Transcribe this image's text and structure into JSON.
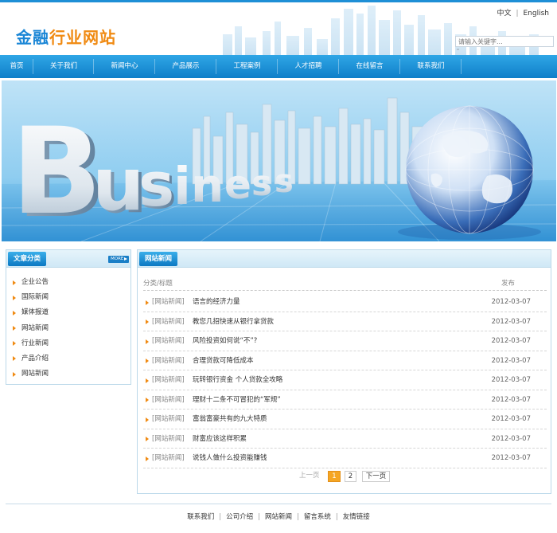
{
  "header": {
    "logo_part1": "金融",
    "logo_part2": "行业网站",
    "lang_zh": "中文",
    "lang_sep": "|",
    "lang_en": "English",
    "search_placeholder": "请输入关键字..."
  },
  "nav": {
    "items": [
      {
        "label": "首页"
      },
      {
        "label": "关于我们"
      },
      {
        "label": "新闻中心"
      },
      {
        "label": "产品展示"
      },
      {
        "label": "工程案例"
      },
      {
        "label": "人才招聘"
      },
      {
        "label": "在线留言"
      },
      {
        "label": "联系我们"
      }
    ]
  },
  "banner": {
    "word": "Business"
  },
  "sidebar": {
    "title": "文章分类",
    "more_label": "MORE",
    "items": [
      {
        "label": "企业公告"
      },
      {
        "label": "国际新闻"
      },
      {
        "label": "媒体报道"
      },
      {
        "label": "网站新闻"
      },
      {
        "label": "行业新闻"
      },
      {
        "label": "产品介绍"
      },
      {
        "label": "网站新闻"
      }
    ]
  },
  "main": {
    "title": "网站新闻",
    "col_category_title": "分类/标题",
    "col_date": "发布",
    "rows": [
      {
        "category": "[网站新闻]",
        "title": "语言的经济力量",
        "date": "2012-03-07"
      },
      {
        "category": "[网站新闻]",
        "title": "教您几招快速从银行拿贷款",
        "date": "2012-03-07"
      },
      {
        "category": "[网站新闻]",
        "title": "风险投资如何说“不”?",
        "date": "2012-03-07"
      },
      {
        "category": "[网站新闻]",
        "title": "合理贷款可降低成本",
        "date": "2012-03-07"
      },
      {
        "category": "[网站新闻]",
        "title": "玩转银行资金 个人贷款全攻略",
        "date": "2012-03-07"
      },
      {
        "category": "[网站新闻]",
        "title": "理财十二条不可冒犯的“军规”",
        "date": "2012-03-07"
      },
      {
        "category": "[网站新闻]",
        "title": "富翁富豪共有的九大特质",
        "date": "2012-03-07"
      },
      {
        "category": "[网站新闻]",
        "title": "财富应该这样积累",
        "date": "2012-03-07"
      },
      {
        "category": "[网站新闻]",
        "title": "说钱人做什么投资能赚钱",
        "date": "2012-03-07"
      }
    ],
    "pager": {
      "prev": "上一页",
      "page1": "1",
      "page2": "2",
      "next": "下一页"
    }
  },
  "footer": {
    "links": [
      {
        "label": "联系我们"
      },
      {
        "label": "公司介绍"
      },
      {
        "label": "网站新闻"
      },
      {
        "label": "留言系统"
      },
      {
        "label": "友情链接"
      }
    ],
    "sep": "|"
  },
  "colors": {
    "accent_blue": "#1e8fd6",
    "logo_orange": "#f08a12",
    "pager_active": "#f5a623"
  }
}
